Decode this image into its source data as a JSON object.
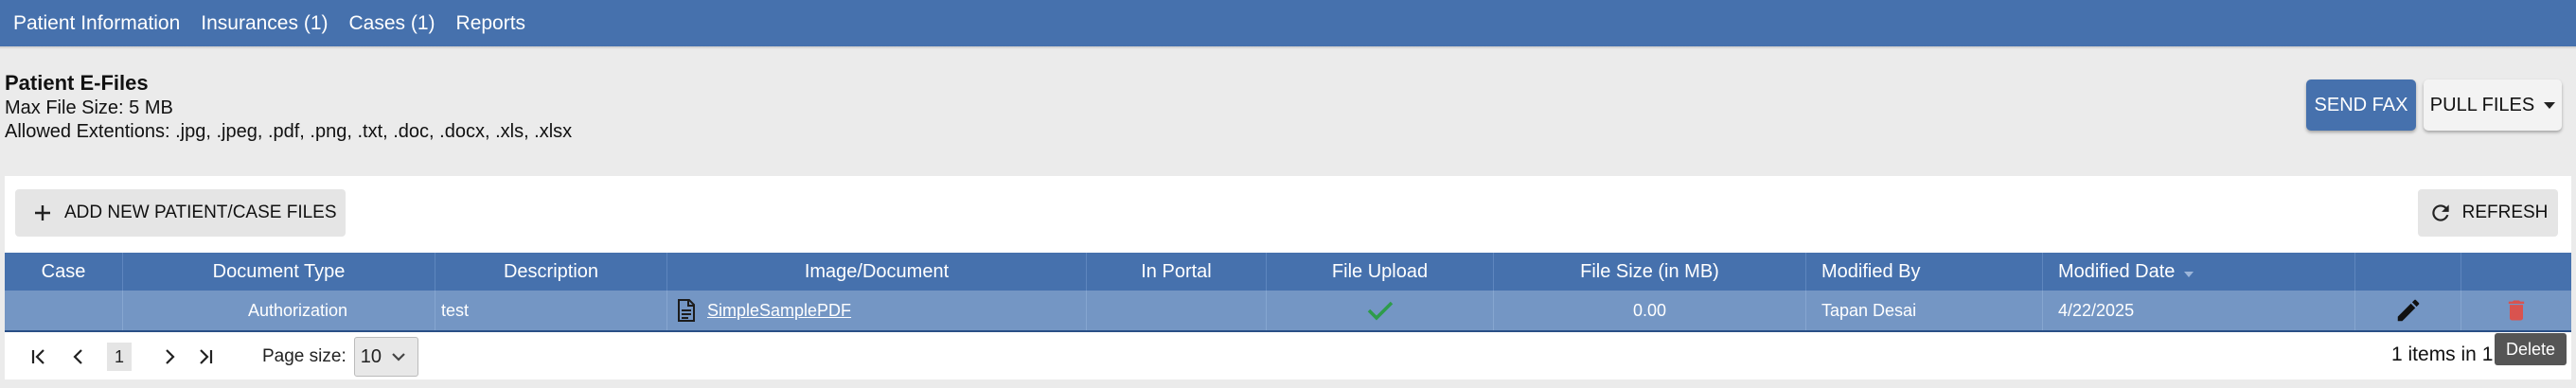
{
  "nav": {
    "items": [
      {
        "label": "Patient Information"
      },
      {
        "label": "Insurances (1)"
      },
      {
        "label": "Cases (1)"
      },
      {
        "label": "Reports"
      }
    ]
  },
  "header": {
    "title": "Patient E-Files",
    "max_file_size": "Max File Size: 5 MB",
    "allowed_extensions": "Allowed Extentions: .jpg, .jpeg, .pdf, .png, .txt, .doc, .docx, .xls, .xlsx"
  },
  "actions": {
    "send_fax_label": "Send Fax",
    "pull_files_label": "Pull Files"
  },
  "toolbar": {
    "add_label": "Add New Patient/Case Files",
    "refresh_label": "Refresh"
  },
  "grid": {
    "columns": [
      "Case",
      "Document Type",
      "Description",
      "Image/Document",
      "In Portal",
      "File Upload",
      "File Size (in MB)",
      "Modified By",
      "Modified Date"
    ],
    "rows": [
      {
        "case": "",
        "document_type": "Authorization",
        "description": "test",
        "document": "SimpleSamplePDF",
        "in_portal": "",
        "file_upload": "check-icon",
        "file_size": "0.00",
        "modified_by": "Tapan Desai",
        "modified_date": "4/22/2025"
      }
    ]
  },
  "pager": {
    "current_page": "1",
    "page_size_label": "Page size:",
    "page_size_value": "10",
    "items_info": "1 items in 1"
  },
  "tooltip": {
    "text": "Delete"
  },
  "colors": {
    "nav_bg": "#4671ad",
    "row_selected": "#7496c4",
    "check": "#2e9c4a",
    "delete": "#d9534f"
  }
}
